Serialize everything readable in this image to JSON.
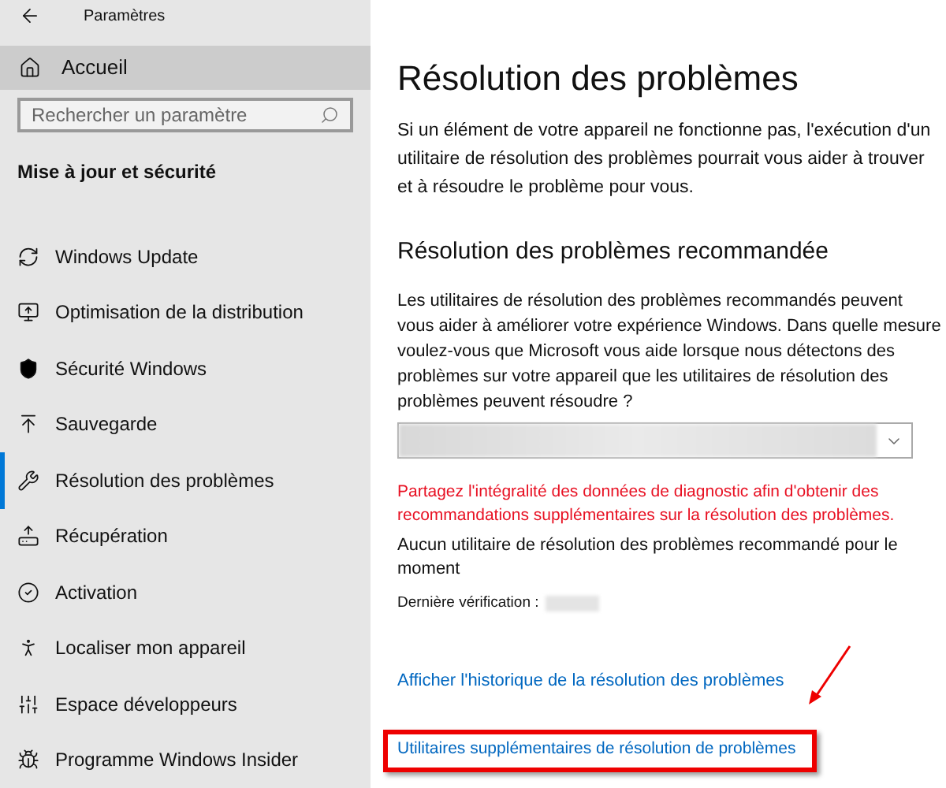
{
  "window": {
    "title": "Paramètres"
  },
  "sidebar": {
    "home": "Accueil",
    "search": {
      "placeholder": "Rechercher un paramètre"
    },
    "section": "Mise à jour et sécurité",
    "items": [
      {
        "label": "Windows Update",
        "selected": false
      },
      {
        "label": "Optimisation de la distribution",
        "selected": false
      },
      {
        "label": "Sécurité Windows",
        "selected": false
      },
      {
        "label": "Sauvegarde",
        "selected": false
      },
      {
        "label": "Résolution des problèmes",
        "selected": true
      },
      {
        "label": "Récupération",
        "selected": false
      },
      {
        "label": "Activation",
        "selected": false
      },
      {
        "label": "Localiser mon appareil",
        "selected": false
      },
      {
        "label": "Espace développeurs",
        "selected": false
      },
      {
        "label": "Programme Windows Insider",
        "selected": false
      }
    ]
  },
  "main": {
    "title": "Résolution des problèmes",
    "intro": "Si un élément de votre appareil ne fonctionne pas, l'exécution d'un utilitaire de résolution des problèmes pourrait vous aider à trouver et à résoudre le problème pour vous.",
    "recommended": {
      "heading": "Résolution des problèmes recommandée",
      "description": "Les utilitaires de résolution des problèmes recommandés peuvent vous aider à améliorer votre expérience Windows. Dans quelle mesure voulez-vous que Microsoft vous aide lorsque nous détectons des problèmes sur votre appareil que les utilitaires de résolution des problèmes peuvent résoudre ?",
      "warning": "Partagez l'intégralité des données de diagnostic afin d'obtenir des recommandations supplémentaires sur la résolution des problèmes.",
      "status": "Aucun utilitaire de résolution des problèmes recommandé pour le moment",
      "last_check": "Dernière vérification :"
    },
    "links": [
      "Afficher l'historique de la résolution des problèmes",
      "Utilitaires supplémentaires de résolution de problèmes"
    ]
  }
}
